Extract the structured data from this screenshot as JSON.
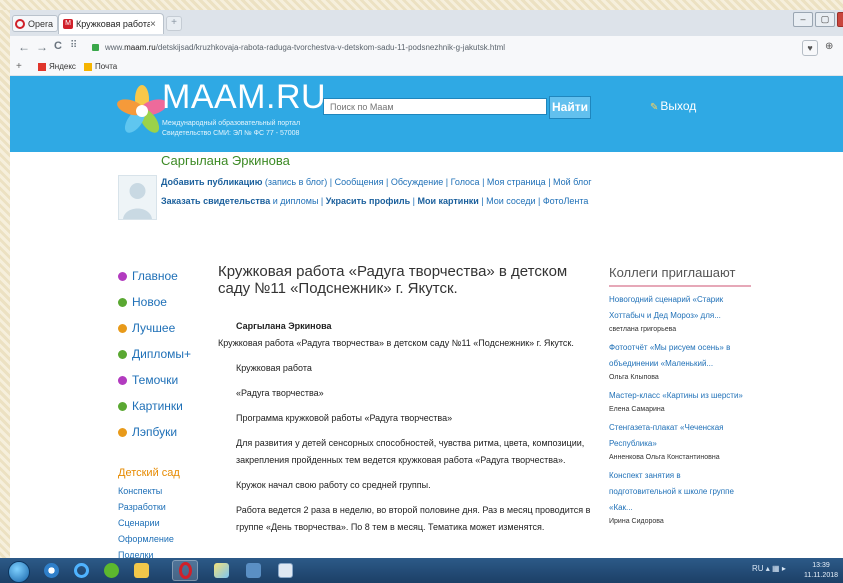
{
  "browser": {
    "menu_label": "Opera",
    "tab_title": "Кружковая работа «Радуг",
    "tab_close": "×",
    "new_tab": "+",
    "window_controls": [
      "–",
      "▢",
      "✕"
    ],
    "nav": [
      "←",
      "→",
      "C",
      "⠿"
    ],
    "url_prefix": "www.",
    "url_domain": "maam.ru",
    "url_path": "/detskijsad/kruzhkovaja-rabota-raduga-tvorchestva-v-detskom-sadu-11-podsnezhnik-g-jakutsk.html",
    "heart": "♥",
    "ext": "⊕"
  },
  "bookmarks": {
    "plus": "+",
    "items": [
      "Яндекс",
      "Почта"
    ]
  },
  "site": {
    "logo": "MAAM.RU",
    "subtitle_1": "Международный образовательный портал",
    "subtitle_2": "Свидетельство СМИ: ЭЛ № ФС 77 - 57008",
    "search_placeholder": "Поиск по Маам",
    "search_button": "Найти",
    "exit_label": "Выход",
    "accent": "#2fa9e4"
  },
  "profile": {
    "name": "Саргылана Эркинова",
    "links_row1": [
      {
        "text": "Добавить публикацию",
        "strong": true
      },
      {
        "text": " (запись в блог) | ",
        "strong": false
      },
      {
        "text": "Сообщения",
        "strong": false
      },
      {
        "text": " | ",
        "strong": false
      },
      {
        "text": "Обсуждение",
        "strong": false
      },
      {
        "text": " | ",
        "strong": false
      },
      {
        "text": "Голоса",
        "strong": false
      },
      {
        "text": " | ",
        "strong": false
      },
      {
        "text": "Моя страница",
        "strong": false
      },
      {
        "text": " | ",
        "strong": false
      },
      {
        "text": "Мой блог",
        "strong": false
      }
    ],
    "links_row2": [
      {
        "text": "Заказать свидетельства",
        "strong": true
      },
      {
        "text": " и дипломы | ",
        "strong": false
      },
      {
        "text": "Украсить профиль",
        "strong": true
      },
      {
        "text": " | ",
        "strong": false
      },
      {
        "text": "Мои картинки",
        "strong": true
      },
      {
        "text": " | ",
        "strong": false
      },
      {
        "text": "Мои соседи",
        "strong": false
      },
      {
        "text": " | ",
        "strong": false
      },
      {
        "text": "ФотоЛента",
        "strong": false
      }
    ]
  },
  "menu": {
    "items": [
      {
        "label": "Главное",
        "color": "#b23bbf"
      },
      {
        "label": "Новое",
        "color": "#5aa832"
      },
      {
        "label": "Лучшее",
        "color": "#e89a1a"
      },
      {
        "label": "Дипломы+",
        "color": "#5aa832"
      },
      {
        "label": "Темочки",
        "color": "#b23bbf"
      },
      {
        "label": "Картинки",
        "color": "#5aa832"
      },
      {
        "label": "Лэпбуки",
        "color": "#e89a1a"
      }
    ],
    "section_head": "Детский сад",
    "sub_items": [
      "Конспекты",
      "Разработки",
      "Сценарии",
      "Оформление",
      "Поделки"
    ]
  },
  "article": {
    "title": "Кружковая работа «Радуга творчества» в детском саду №11 «Подснежник» г. Якутск.",
    "author": "Саргылана Эркинова",
    "lead": "Кружковая работа «Радуга творчества» в детском саду №11 «Подснежник» г. Якутск.",
    "p1": "Кружковая работа",
    "p2": "«Радуга творчества»",
    "p3": "Программа кружковой работы «Радуга творчества»",
    "p4": "Для развития у детей сенсорных способностей, чувства ритма, цвета, композиции, закрепления пройденных тем ведется кружковая работа «Радуга творчества».",
    "p5": "Кружок начал свою работу со средней группы.",
    "p6": "Работа ведется 2 раза в неделю, во второй половине дня. Раз в месяц проводится в группе «День творчества». По 8 тем в месяц. Тематика может изменятся."
  },
  "colleagues": {
    "heading": "Коллеги приглашают",
    "items": [
      {
        "title": "Новогодний сценарий «Старик Хоттабыч и Дед Мороз» для...",
        "author": "светлана григорьева"
      },
      {
        "title": "Фотоотчёт «Мы рисуем осень» в объединении «Маленький...",
        "author": "Ольга Клыпова"
      },
      {
        "title": "Мастер-класс «Картины из шерсти»",
        "author": "Елена Самарина"
      },
      {
        "title": "Стенгазета-плакат «Чеченская Республика»",
        "author": "Анненкова Ольга Константиновна"
      },
      {
        "title": "Конспект занятия в подготовительной к школе группе «Как...",
        "author": "Ирина Сидорова"
      }
    ]
  },
  "taskbar": {
    "tray_lang": "RU",
    "tray_icons": "▴ ▦ ▸",
    "time": "13:39",
    "date": "11.11.2018"
  }
}
